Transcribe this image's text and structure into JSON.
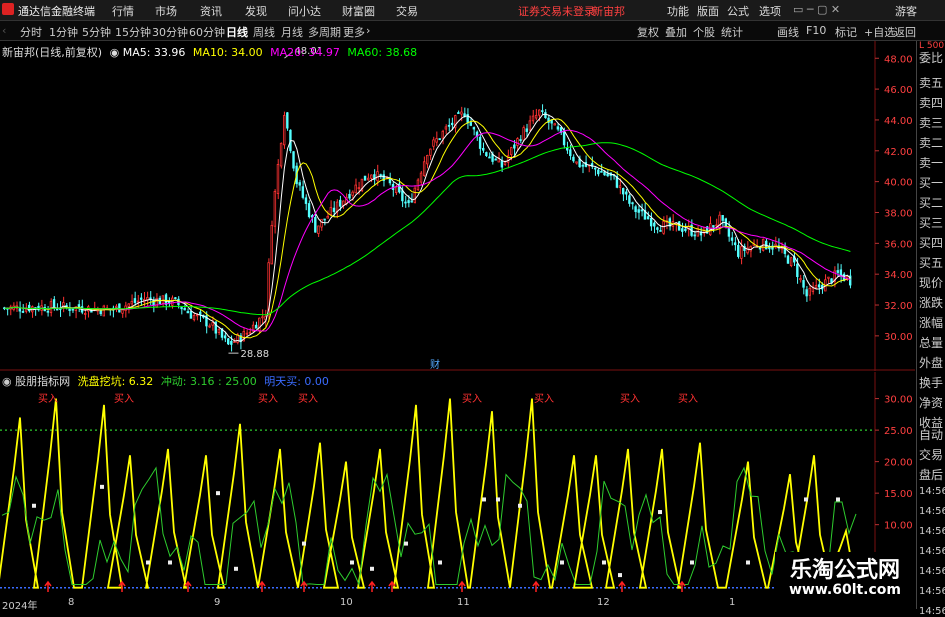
{
  "titlebar": {
    "app": "通达信金融终端",
    "menu": [
      "行情",
      "市场",
      "资讯",
      "发现",
      "问小达",
      "财富圈",
      "交易"
    ],
    "notice": "证券交易未登录",
    "stock": "新宙邦",
    "right": [
      "功能",
      "版面",
      "公式",
      "选项"
    ],
    "guest": "游客"
  },
  "toolbar": {
    "periods": [
      "分时",
      "1分钟",
      "5分钟",
      "15分钟",
      "30分钟",
      "60分钟",
      "日线",
      "周线",
      "月线",
      "多周期",
      "更多"
    ],
    "active": "日线",
    "right": [
      "复权",
      "叠加",
      "个股",
      "统计",
      "画线",
      "F10",
      "标记",
      "+自选",
      "返回"
    ]
  },
  "main_legend": {
    "name": "新宙邦(日线,前复权)",
    "ma5": "MA5: 33.96",
    "ma10": "MA10: 34.00",
    "ma20": "MA20: 34.97",
    "ma60": "MA60: 38.68",
    "high_label": "48.01",
    "low_label": "28.88",
    "marker": "财"
  },
  "ind_legend": {
    "name": "股朋指标网",
    "a": "洗盘挖坑: 6.32",
    "b": "冲动: 3.16 : 25.00",
    "c": "明天买: 0.00",
    "buy": "买入"
  },
  "price_axis": [
    "48.00",
    "46.00",
    "44.00",
    "42.00",
    "40.00",
    "38.00",
    "36.00",
    "34.00",
    "32.00",
    "30.00"
  ],
  "ind_axis": [
    "30.00",
    "25.00",
    "20.00",
    "15.00",
    "10.00",
    "5.00"
  ],
  "x_axis": [
    "2024年",
    "8",
    "9",
    "10",
    "11",
    "12",
    "1"
  ],
  "side_panel": [
    "L 500",
    "委比",
    "卖五",
    "卖四",
    "卖三",
    "卖二",
    "卖一",
    "买一",
    "买二",
    "买三",
    "买四",
    "买五",
    "现价",
    "涨跌",
    "涨幅",
    "总量",
    "外盘",
    "换手",
    "净资",
    "收益",
    "自动",
    "交易",
    "盘后",
    "14:56",
    "14:56",
    "14:56",
    "14:56",
    "14:56",
    "14:56",
    "14:56"
  ],
  "watermark": {
    "line1": "乐淘公式网",
    "line2": "www.60lt.com"
  },
  "colors": {
    "up": "#ff3232",
    "down": "#54ffff",
    "ma5": "#ffffff",
    "ma10": "#ffff00",
    "ma20": "#ff00ff",
    "ma60": "#00ff00",
    "yellow": "#ffff00",
    "green": "#2ecc2e",
    "blue": "#3a6bff"
  }
}
